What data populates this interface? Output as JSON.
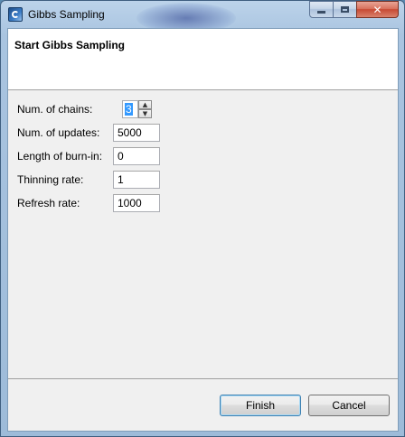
{
  "window": {
    "title": "Gibbs Sampling",
    "controls": {
      "minimize_icon": "minimize-icon",
      "maximize_icon": "maximize-icon",
      "close_icon": "close-icon",
      "close_glyph": "✕"
    }
  },
  "banner": {
    "title": "Start Gibbs Sampling"
  },
  "form": {
    "chains": {
      "label": "Num. of chains:",
      "value": "3",
      "up": "▲",
      "down": "▼"
    },
    "updates": {
      "label": "Num. of updates:",
      "value": "5000"
    },
    "burnin": {
      "label": "Length of burn-in:",
      "value": "0"
    },
    "thinning": {
      "label": "Thinning rate:",
      "value": "1"
    },
    "refresh": {
      "label": "Refresh rate:",
      "value": "1000"
    }
  },
  "buttons": {
    "finish": "Finish",
    "cancel": "Cancel"
  },
  "colors": {
    "close_button": "#c74a34",
    "selection": "#3399ff",
    "default_button_border": "#3c7fb1"
  }
}
